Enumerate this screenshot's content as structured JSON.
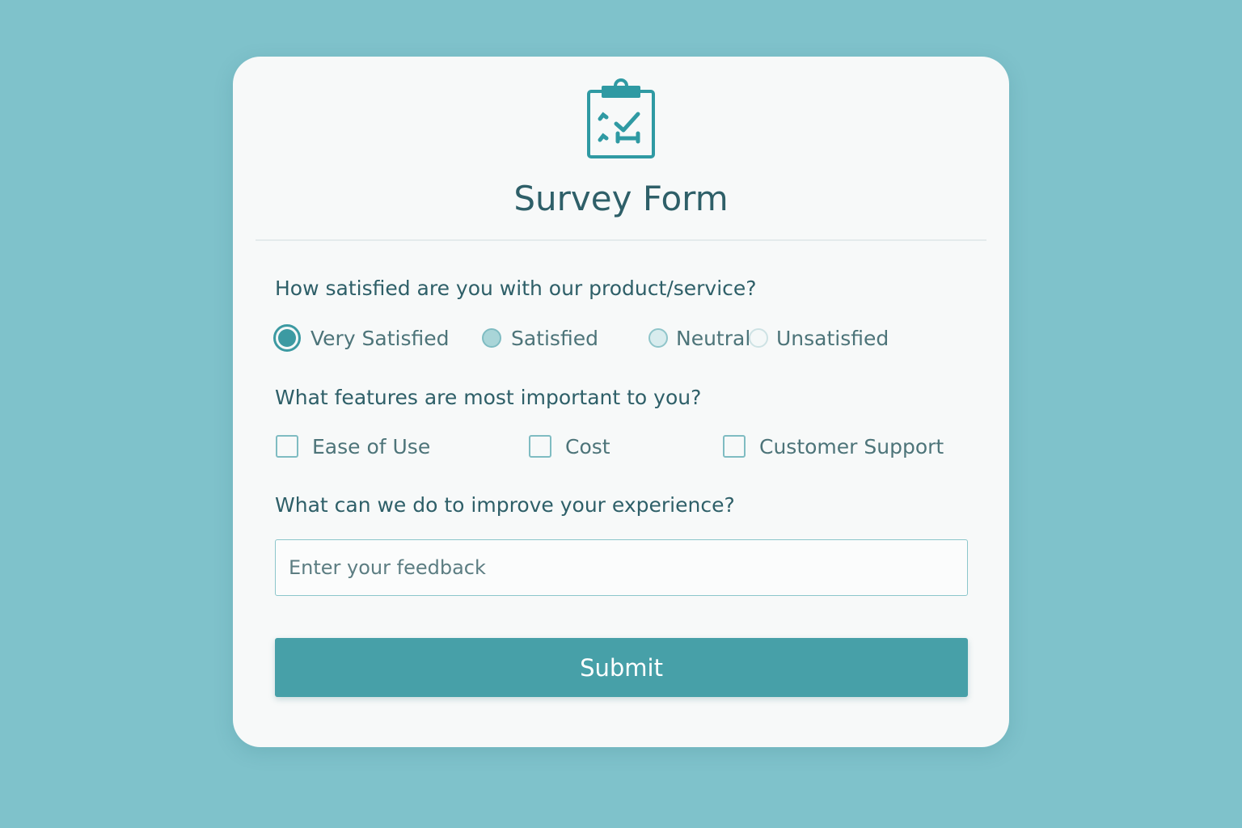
{
  "form": {
    "title": "Survey Form",
    "header_icon": "clipboard-checklist-icon",
    "accent_color": "#47a0a8",
    "title_color": "#2e5f68",
    "background_color": "#7fc2cb"
  },
  "satisfaction": {
    "question": "How satisfied are you with our product/service?",
    "selected": "Very Satisfied",
    "options": [
      {
        "label": "Very Satisfied"
      },
      {
        "label": "Satisfied"
      },
      {
        "label": "Neutral"
      },
      {
        "label": "Unsatisfied"
      }
    ]
  },
  "features": {
    "question": "What features are most important to you?",
    "options": [
      {
        "label": "Ease of Use",
        "checked": false
      },
      {
        "label": "Cost",
        "checked": false
      },
      {
        "label": "Customer Support",
        "checked": false
      }
    ]
  },
  "feedback": {
    "question": "What can we do to improve your experience?",
    "placeholder": "Enter your feedback",
    "value": ""
  },
  "submit": {
    "label": "Submit"
  }
}
